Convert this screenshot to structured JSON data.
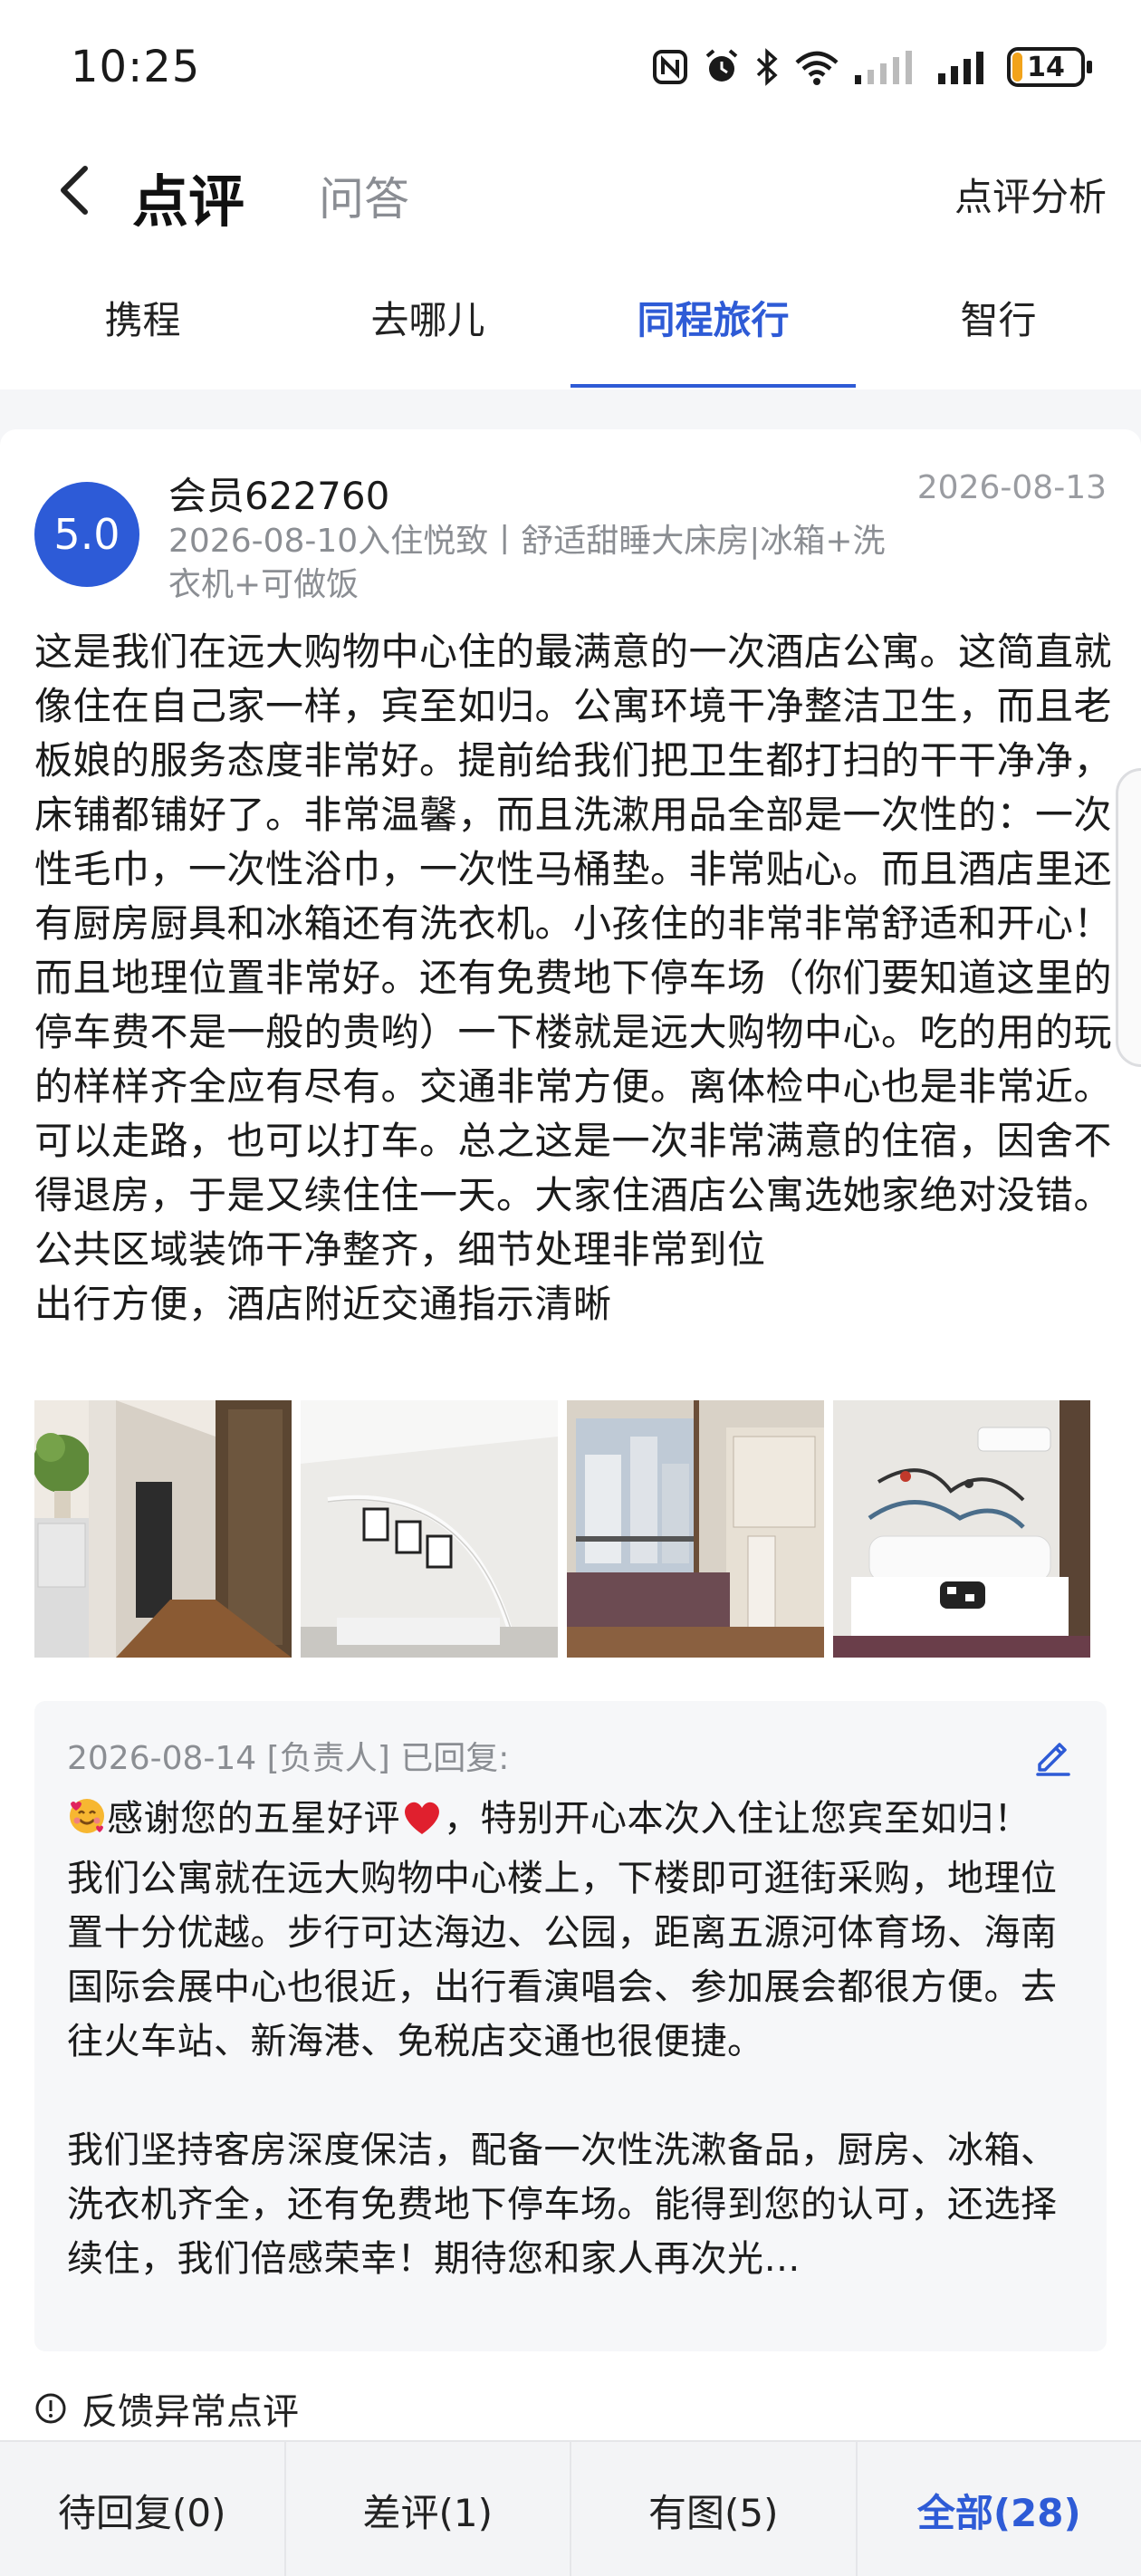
{
  "status_bar": {
    "time": "10:25",
    "battery": "14",
    "battery_level": 0.14,
    "battery_color": "#f2a31b",
    "icons": [
      "nfc-icon",
      "alarm-icon",
      "bluetooth-icon",
      "wifi-icon",
      "signal-icon",
      "signal-icon",
      "battery-icon"
    ]
  },
  "header": {
    "title": "点评",
    "second_tab": "问答",
    "right_action": "点评分析"
  },
  "platform_tabs": [
    {
      "label": "携程",
      "active": false
    },
    {
      "label": "去哪儿",
      "active": false
    },
    {
      "label": "同程旅行",
      "active": true
    },
    {
      "label": "智行",
      "active": false
    }
  ],
  "review": {
    "score": "5.0",
    "member": "会员622760",
    "date": "2026-08-13",
    "stay_info": "2026-08-10入住悦致丨舒适甜睡大床房|冰箱+洗衣机+可做饭",
    "text": "这是我们在远大购物中心住的最满意的一次酒店公寓。这简直就像住在自己家一样，宾至如归。公寓环境干净整洁卫生，而且老板娘的服务态度非常好。提前给我们把卫生都打扫的干干净净，床铺都铺好了。非常温馨，而且洗漱用品全部是一次性的：一次性毛巾，一次性浴巾，一次性马桶垫。非常贴心。而且酒店里还有厨房厨具和冰箱还有洗衣机。小孩住的非常非常舒适和开心！而且地理位置非常好。还有免费地下停车场（你们要知道这里的停车费不是一般的贵哟）一下楼就是远大购物中心。吃的用的玩的样样齐全应有尽有。交通非常方便。离体检中心也是非常近。可以走路，也可以打车。总之这是一次非常满意的住宿，因舍不得退房，于是又续住住一天。大家住酒店公寓选她家绝对没错。\n公共区域装饰干净整齐，细节处理非常到位\n出行方便，酒店附近交通指示清晰",
    "photos": [
      "hallway-photo",
      "bedroom-wall-photo",
      "balcony-photo",
      "bed-photo"
    ]
  },
  "reply": {
    "meta": "2026-08-14 [负责人] 已回复:",
    "text_before_heart": "感谢您的五星好评",
    "text_after_heart": "，特别开心本次入住让您宾至如归！\n我们公寓就在远大购物中心楼上，下楼即可逛街采购，地理位置十分优越。步行可达海边、公园，距离五源河体育场、海南国际会展中心也很近，出行看演唱会、参加展会都很方便。去往火车站、新海港、免税店交通也很便捷。\n\n我们坚持客房深度保洁，配备一次性洗漱备品，厨房、冰箱、洗衣机齐全，还有免费地下停车场。能得到您的认可，还选择续住，我们倍感荣幸！期待您和家人再次光…"
  },
  "peek_text": "反馈异常点评",
  "bottom_filters": [
    {
      "label": "待回复(0)",
      "active": false
    },
    {
      "label": "差评(1)",
      "active": false
    },
    {
      "label": "有图(5)",
      "active": false
    },
    {
      "label": "全部(28)",
      "active": true
    }
  ],
  "colors": {
    "accent": "#2e5bd6",
    "badge": "#2d5bd7"
  }
}
